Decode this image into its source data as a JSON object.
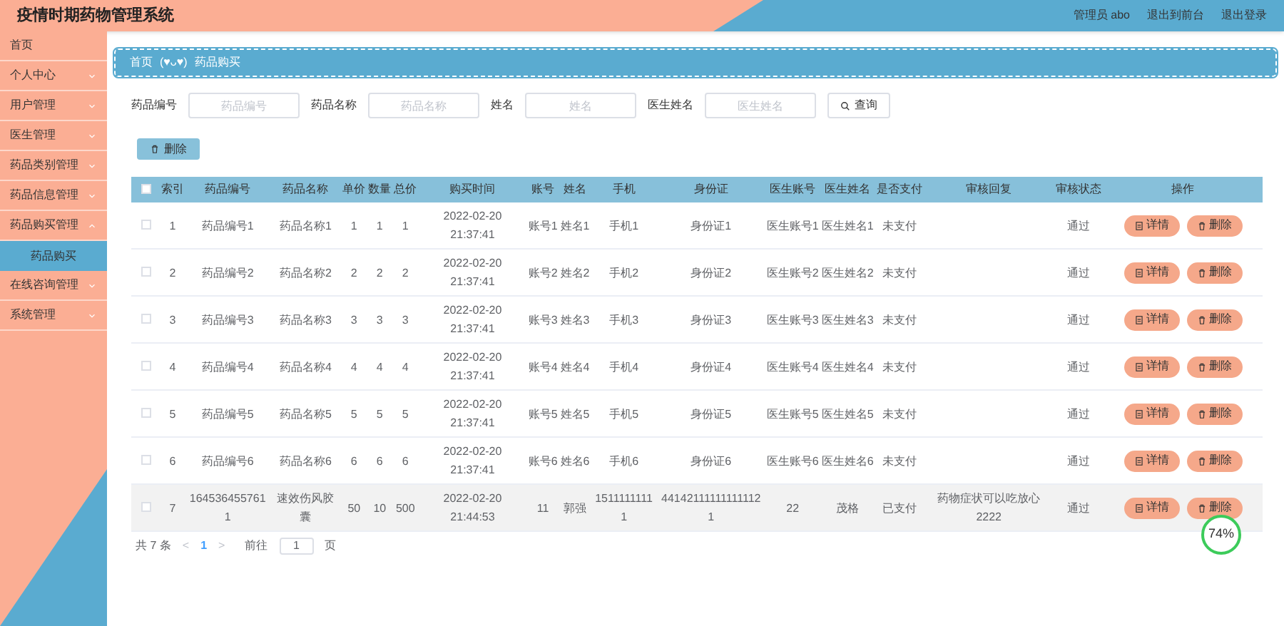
{
  "header": {
    "title": "疫情时期药物管理系统",
    "links": [
      "管理员 abo",
      "退出到前台",
      "退出登录"
    ]
  },
  "sidebar": {
    "items": [
      {
        "label": "首页",
        "expandable": false
      },
      {
        "label": "个人中心",
        "expandable": true,
        "expanded": false
      },
      {
        "label": "用户管理",
        "expandable": true,
        "expanded": false
      },
      {
        "label": "医生管理",
        "expandable": true,
        "expanded": false
      },
      {
        "label": "药品类别管理",
        "expandable": true,
        "expanded": false
      },
      {
        "label": "药品信息管理",
        "expandable": true,
        "expanded": false
      },
      {
        "label": "药品购买管理",
        "expandable": true,
        "expanded": true,
        "children": [
          {
            "label": "药品购买",
            "selected": true
          }
        ]
      },
      {
        "label": "在线咨询管理",
        "expandable": true,
        "expanded": false
      },
      {
        "label": "系统管理",
        "expandable": true,
        "expanded": false
      }
    ]
  },
  "breadcrumb": [
    "首页",
    "(♥ᴗ♥)",
    "药品购买"
  ],
  "search": {
    "fields": [
      {
        "label": "药品编号",
        "placeholder": "药品编号"
      },
      {
        "label": "药品名称",
        "placeholder": "药品名称"
      },
      {
        "label": "姓名",
        "placeholder": "姓名"
      },
      {
        "label": "医生姓名",
        "placeholder": "医生姓名"
      }
    ],
    "button": "查询"
  },
  "bulk_delete_button": "删除",
  "table": {
    "select_all": false,
    "columns": [
      "索引",
      "药品编号",
      "药品名称",
      "单价",
      "数量",
      "总价",
      "购买时间",
      "账号",
      "姓名",
      "手机",
      "身份证",
      "医生账号",
      "医生姓名",
      "是否支付",
      "审核回复",
      "审核状态",
      "操作"
    ],
    "rows": [
      {
        "checked": false,
        "hovered": false,
        "cells": [
          "1",
          "药品编号1",
          "药品名称1",
          "1",
          "1",
          "1",
          "2022-02-20 21:37:41",
          "账号1",
          "姓名1",
          "手机1",
          "身份证1",
          "医生账号1",
          "医生姓名1",
          "未支付",
          "",
          "通过"
        ],
        "actions": [
          "详情",
          "删除"
        ]
      },
      {
        "checked": false,
        "hovered": false,
        "cells": [
          "2",
          "药品编号2",
          "药品名称2",
          "2",
          "2",
          "2",
          "2022-02-20 21:37:41",
          "账号2",
          "姓名2",
          "手机2",
          "身份证2",
          "医生账号2",
          "医生姓名2",
          "未支付",
          "",
          "通过"
        ],
        "actions": [
          "详情",
          "删除"
        ]
      },
      {
        "checked": false,
        "hovered": false,
        "cells": [
          "3",
          "药品编号3",
          "药品名称3",
          "3",
          "3",
          "3",
          "2022-02-20 21:37:41",
          "账号3",
          "姓名3",
          "手机3",
          "身份证3",
          "医生账号3",
          "医生姓名3",
          "未支付",
          "",
          "通过"
        ],
        "actions": [
          "详情",
          "删除"
        ]
      },
      {
        "checked": false,
        "hovered": false,
        "cells": [
          "4",
          "药品编号4",
          "药品名称4",
          "4",
          "4",
          "4",
          "2022-02-20 21:37:41",
          "账号4",
          "姓名4",
          "手机4",
          "身份证4",
          "医生账号4",
          "医生姓名4",
          "未支付",
          "",
          "通过"
        ],
        "actions": [
          "详情",
          "删除"
        ]
      },
      {
        "checked": false,
        "hovered": false,
        "cells": [
          "5",
          "药品编号5",
          "药品名称5",
          "5",
          "5",
          "5",
          "2022-02-20 21:37:41",
          "账号5",
          "姓名5",
          "手机5",
          "身份证5",
          "医生账号5",
          "医生姓名5",
          "未支付",
          "",
          "通过"
        ],
        "actions": [
          "详情",
          "删除"
        ]
      },
      {
        "checked": false,
        "hovered": false,
        "cells": [
          "6",
          "药品编号6",
          "药品名称6",
          "6",
          "6",
          "6",
          "2022-02-20 21:37:41",
          "账号6",
          "姓名6",
          "手机6",
          "身份证6",
          "医生账号6",
          "医生姓名6",
          "未支付",
          "",
          "通过"
        ],
        "actions": [
          "详情",
          "删除"
        ]
      },
      {
        "checked": false,
        "hovered": true,
        "cells": [
          "7",
          "1645364557611",
          "速效伤风胶囊",
          "50",
          "10",
          "500",
          "2022-02-20 21:44:53",
          "11",
          "郭强",
          "15111111111",
          "441421111111111121",
          "22",
          "茂格",
          "已支付",
          "药物症状可以吃放心2222",
          "通过"
        ],
        "actions": [
          "详情",
          "删除"
        ]
      }
    ]
  },
  "pagination": {
    "total": "共 7 条",
    "prev": "<",
    "pages": [
      {
        "label": "1",
        "selected": true
      }
    ],
    "next": ">",
    "goto_label": "前往",
    "goto_value": "1",
    "goto_suffix": "页"
  },
  "monitor_badge": {
    "percent": "74%"
  }
}
